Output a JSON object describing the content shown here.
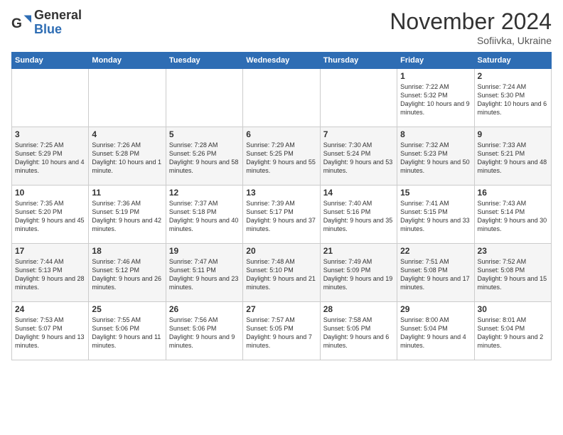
{
  "header": {
    "logo_general": "General",
    "logo_blue": "Blue",
    "month_title": "November 2024",
    "location": "Sofiivka, Ukraine"
  },
  "days_of_week": [
    "Sunday",
    "Monday",
    "Tuesday",
    "Wednesday",
    "Thursday",
    "Friday",
    "Saturday"
  ],
  "weeks": [
    [
      {
        "day": "",
        "info": ""
      },
      {
        "day": "",
        "info": ""
      },
      {
        "day": "",
        "info": ""
      },
      {
        "day": "",
        "info": ""
      },
      {
        "day": "",
        "info": ""
      },
      {
        "day": "1",
        "info": "Sunrise: 7:22 AM\nSunset: 5:32 PM\nDaylight: 10 hours and 9 minutes."
      },
      {
        "day": "2",
        "info": "Sunrise: 7:24 AM\nSunset: 5:30 PM\nDaylight: 10 hours and 6 minutes."
      }
    ],
    [
      {
        "day": "3",
        "info": "Sunrise: 7:25 AM\nSunset: 5:29 PM\nDaylight: 10 hours and 4 minutes."
      },
      {
        "day": "4",
        "info": "Sunrise: 7:26 AM\nSunset: 5:28 PM\nDaylight: 10 hours and 1 minute."
      },
      {
        "day": "5",
        "info": "Sunrise: 7:28 AM\nSunset: 5:26 PM\nDaylight: 9 hours and 58 minutes."
      },
      {
        "day": "6",
        "info": "Sunrise: 7:29 AM\nSunset: 5:25 PM\nDaylight: 9 hours and 55 minutes."
      },
      {
        "day": "7",
        "info": "Sunrise: 7:30 AM\nSunset: 5:24 PM\nDaylight: 9 hours and 53 minutes."
      },
      {
        "day": "8",
        "info": "Sunrise: 7:32 AM\nSunset: 5:23 PM\nDaylight: 9 hours and 50 minutes."
      },
      {
        "day": "9",
        "info": "Sunrise: 7:33 AM\nSunset: 5:21 PM\nDaylight: 9 hours and 48 minutes."
      }
    ],
    [
      {
        "day": "10",
        "info": "Sunrise: 7:35 AM\nSunset: 5:20 PM\nDaylight: 9 hours and 45 minutes."
      },
      {
        "day": "11",
        "info": "Sunrise: 7:36 AM\nSunset: 5:19 PM\nDaylight: 9 hours and 42 minutes."
      },
      {
        "day": "12",
        "info": "Sunrise: 7:37 AM\nSunset: 5:18 PM\nDaylight: 9 hours and 40 minutes."
      },
      {
        "day": "13",
        "info": "Sunrise: 7:39 AM\nSunset: 5:17 PM\nDaylight: 9 hours and 37 minutes."
      },
      {
        "day": "14",
        "info": "Sunrise: 7:40 AM\nSunset: 5:16 PM\nDaylight: 9 hours and 35 minutes."
      },
      {
        "day": "15",
        "info": "Sunrise: 7:41 AM\nSunset: 5:15 PM\nDaylight: 9 hours and 33 minutes."
      },
      {
        "day": "16",
        "info": "Sunrise: 7:43 AM\nSunset: 5:14 PM\nDaylight: 9 hours and 30 minutes."
      }
    ],
    [
      {
        "day": "17",
        "info": "Sunrise: 7:44 AM\nSunset: 5:13 PM\nDaylight: 9 hours and 28 minutes."
      },
      {
        "day": "18",
        "info": "Sunrise: 7:46 AM\nSunset: 5:12 PM\nDaylight: 9 hours and 26 minutes."
      },
      {
        "day": "19",
        "info": "Sunrise: 7:47 AM\nSunset: 5:11 PM\nDaylight: 9 hours and 23 minutes."
      },
      {
        "day": "20",
        "info": "Sunrise: 7:48 AM\nSunset: 5:10 PM\nDaylight: 9 hours and 21 minutes."
      },
      {
        "day": "21",
        "info": "Sunrise: 7:49 AM\nSunset: 5:09 PM\nDaylight: 9 hours and 19 minutes."
      },
      {
        "day": "22",
        "info": "Sunrise: 7:51 AM\nSunset: 5:08 PM\nDaylight: 9 hours and 17 minutes."
      },
      {
        "day": "23",
        "info": "Sunrise: 7:52 AM\nSunset: 5:08 PM\nDaylight: 9 hours and 15 minutes."
      }
    ],
    [
      {
        "day": "24",
        "info": "Sunrise: 7:53 AM\nSunset: 5:07 PM\nDaylight: 9 hours and 13 minutes."
      },
      {
        "day": "25",
        "info": "Sunrise: 7:55 AM\nSunset: 5:06 PM\nDaylight: 9 hours and 11 minutes."
      },
      {
        "day": "26",
        "info": "Sunrise: 7:56 AM\nSunset: 5:06 PM\nDaylight: 9 hours and 9 minutes."
      },
      {
        "day": "27",
        "info": "Sunrise: 7:57 AM\nSunset: 5:05 PM\nDaylight: 9 hours and 7 minutes."
      },
      {
        "day": "28",
        "info": "Sunrise: 7:58 AM\nSunset: 5:05 PM\nDaylight: 9 hours and 6 minutes."
      },
      {
        "day": "29",
        "info": "Sunrise: 8:00 AM\nSunset: 5:04 PM\nDaylight: 9 hours and 4 minutes."
      },
      {
        "day": "30",
        "info": "Sunrise: 8:01 AM\nSunset: 5:04 PM\nDaylight: 9 hours and 2 minutes."
      }
    ]
  ]
}
